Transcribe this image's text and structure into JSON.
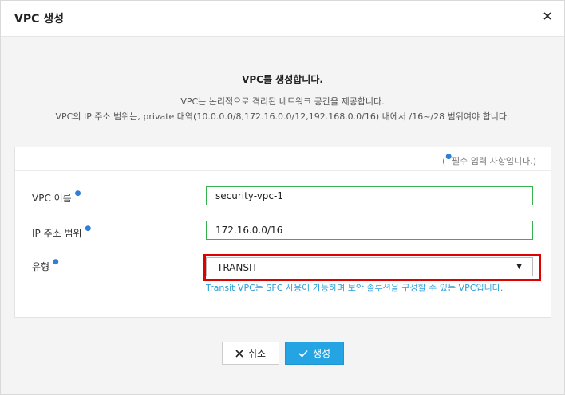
{
  "header": {
    "title": "VPC 생성",
    "close_icon": "close-icon"
  },
  "intro": {
    "title": "VPC를 생성합니다.",
    "line1": "VPC는 논리적으로 격리된 네트워크 공간을 제공합니다.",
    "line2": "VPC의 IP 주소 범위는, private 대역(10.0.0.0/8,172.16.0.0/12,192.168.0.0/16) 내에서 /16~/28 범위여야 합니다."
  },
  "form": {
    "required_note_prefix": "(",
    "required_note_suffix": "필수 입력 사항입니다.)",
    "vpc_name": {
      "label": "VPC 이름",
      "value": "security-vpc-1"
    },
    "ip_range": {
      "label": "IP 주소 범위",
      "value": "172.16.0.0/16"
    },
    "type": {
      "label": "유형",
      "selected": "TRANSIT",
      "caret_icon": "caret-down-icon"
    },
    "type_hint": "Transit VPC는 SFC 사용이 가능하며 보안 솔루션을 구성할 수 있는 VPC입니다.",
    "required_marker": "●"
  },
  "buttons": {
    "cancel": {
      "label": "취소",
      "icon": "x-icon"
    },
    "create": {
      "label": "생성",
      "icon": "check-icon"
    }
  },
  "colors": {
    "accent": "#25a4e4",
    "valid_border": "#37b24d",
    "highlight": "#e00000",
    "hint": "#2a9fd8"
  }
}
